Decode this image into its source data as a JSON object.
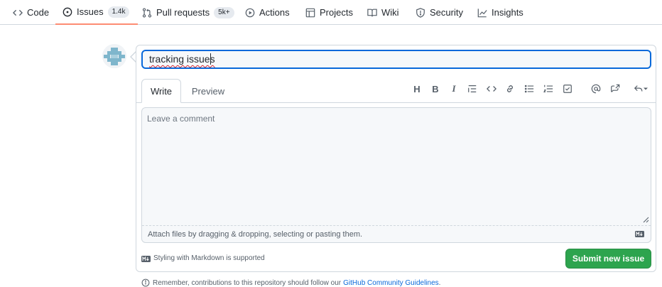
{
  "nav": {
    "tabs": [
      {
        "label": "Code",
        "icon": "code-icon"
      },
      {
        "label": "Issues",
        "icon": "issue-opened-icon",
        "counter": "1.4k",
        "active": true
      },
      {
        "label": "Pull requests",
        "icon": "git-pull-request-icon",
        "counter": "5k+"
      },
      {
        "label": "Actions",
        "icon": "play-icon"
      },
      {
        "label": "Projects",
        "icon": "table-icon"
      },
      {
        "label": "Wiki",
        "icon": "book-icon"
      },
      {
        "label": "Security",
        "icon": "shield-icon"
      },
      {
        "label": "Insights",
        "icon": "graph-icon"
      }
    ]
  },
  "issue_form": {
    "title_value": "tracking issues",
    "write_tab": "Write",
    "preview_tab": "Preview",
    "toolbar": {
      "heading": "H",
      "bold": "B",
      "italic": "I",
      "icons": [
        "quote-icon",
        "code-icon",
        "link-icon",
        "unordered-list-icon",
        "ordered-list-icon",
        "tasklist-icon",
        "mention-icon",
        "cross-reference-icon",
        "reply-icon"
      ]
    },
    "comment_placeholder": "Leave a comment",
    "attach_text": "Attach files by dragging & dropping, selecting or pasting them.",
    "markdown_note": "Styling with Markdown is supported",
    "submit_label": "Submit new issue"
  },
  "footer": {
    "note": "Remember, contributions to this repository should follow our",
    "link": "GitHub Community Guidelines",
    "period": "."
  },
  "colors": {
    "accent": "#0969da",
    "submit": "#2da44e",
    "active_tab_underline": "#fd8c73"
  }
}
